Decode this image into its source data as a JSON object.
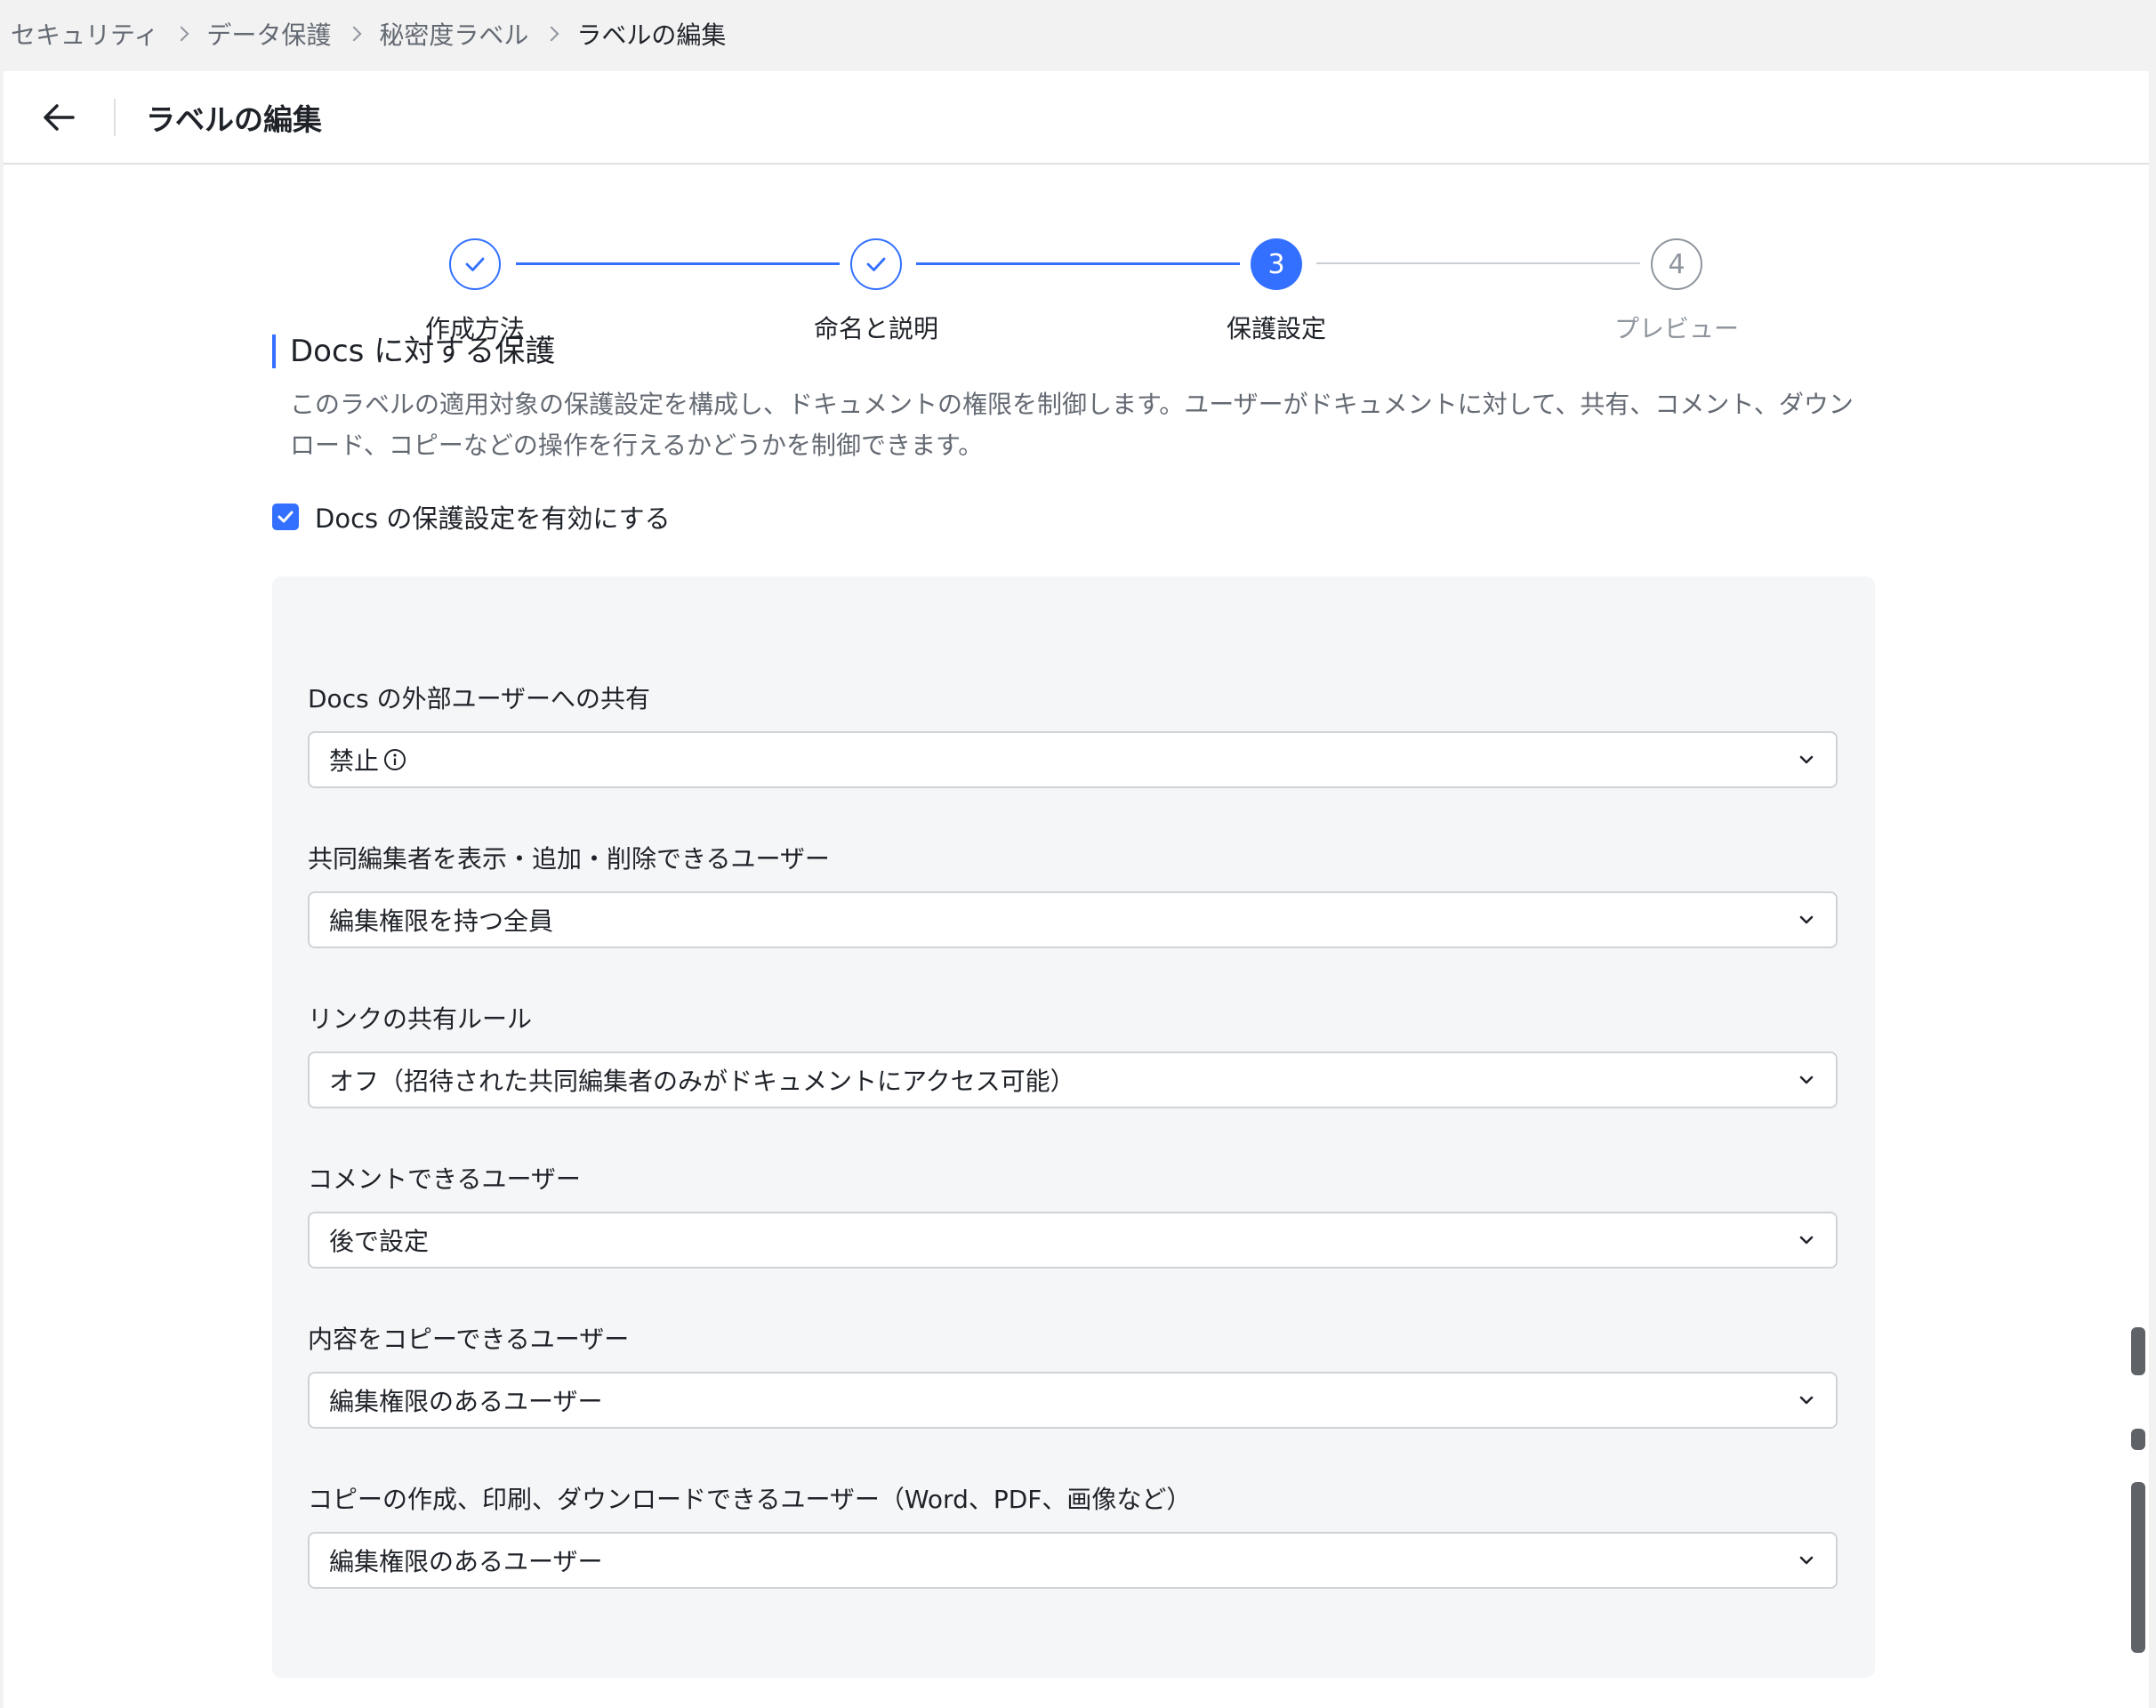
{
  "breadcrumb": [
    "セキュリティ",
    "データ保護",
    "秘密度ラベル",
    "ラベルの編集"
  ],
  "header": {
    "title": "ラベルの編集"
  },
  "stepper": {
    "steps": [
      {
        "label": "作成方法",
        "number": "1",
        "state": "done"
      },
      {
        "label": "命名と説明",
        "number": "2",
        "state": "done"
      },
      {
        "label": "保護設定",
        "number": "3",
        "state": "active"
      },
      {
        "label": "プレビュー",
        "number": "4",
        "state": "todo"
      }
    ]
  },
  "section": {
    "title": "Docs に対する保護",
    "description": "このラベルの適用対象の保護設定を構成し、ドキュメントの権限を制御します。ユーザーがドキュメントに対して、共有、コメント、ダウンロード、コピーなどの操作を行えるかどうかを制御できます。",
    "enable_label": "Docs の保護設定を有効にする",
    "enabled": true
  },
  "fields": [
    {
      "label": "Docs の外部ユーザーへの共有",
      "value": "禁止"
    },
    {
      "label": "共同編集者を表示・追加・削除できるユーザー",
      "value": "編集権限を持つ全員"
    },
    {
      "label": "リンクの共有ルール",
      "value": "オフ（招待された共同編集者のみがドキュメントにアクセス可能）"
    },
    {
      "label": "コメントできるユーザー",
      "value": "後で設定"
    },
    {
      "label": "内容をコピーできるユーザー",
      "value": "編集権限のあるユーザー"
    },
    {
      "label": "コピーの作成、印刷、ダウンロードできるユーザー（Word、PDF、画像など）",
      "value": "編集権限のあるユーザー"
    }
  ],
  "colors": {
    "accent": "#3370ff",
    "text": "#1f2329",
    "muted": "#646a73",
    "panel_bg": "#f5f6f7"
  },
  "icons": [
    "back-arrow-icon",
    "check-icon",
    "chevron-down-icon",
    "info-icon"
  ]
}
